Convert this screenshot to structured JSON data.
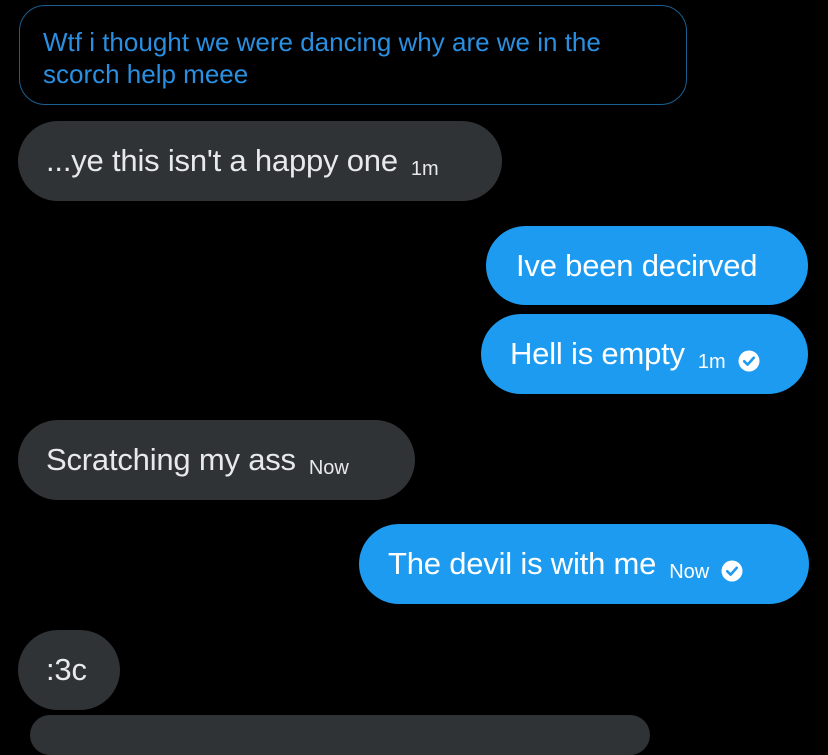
{
  "quoted_message": {
    "text": "Wtf i thought we were dancing why are we in the scorch help meee"
  },
  "messages": [
    {
      "side": "in",
      "text": "...ye this isn't a happy one",
      "time": "1m"
    },
    {
      "side": "out",
      "text": "Ive been decirved",
      "time": ""
    },
    {
      "side": "out",
      "text": "Hell is empty",
      "time": "1m",
      "read_icon": "check-circle-icon"
    },
    {
      "side": "in",
      "text": "Scratching my ass",
      "time": "Now"
    },
    {
      "side": "out",
      "text": "The devil is with me",
      "time": "Now",
      "read_icon": "check-circle-icon"
    },
    {
      "side": "in",
      "text": ":3c",
      "time": ""
    }
  ],
  "colors": {
    "background": "#000000",
    "incoming_bubble": "#2f3336",
    "outgoing_bubble": "#1d9bf0",
    "quote_text": "#2a8fe0"
  }
}
